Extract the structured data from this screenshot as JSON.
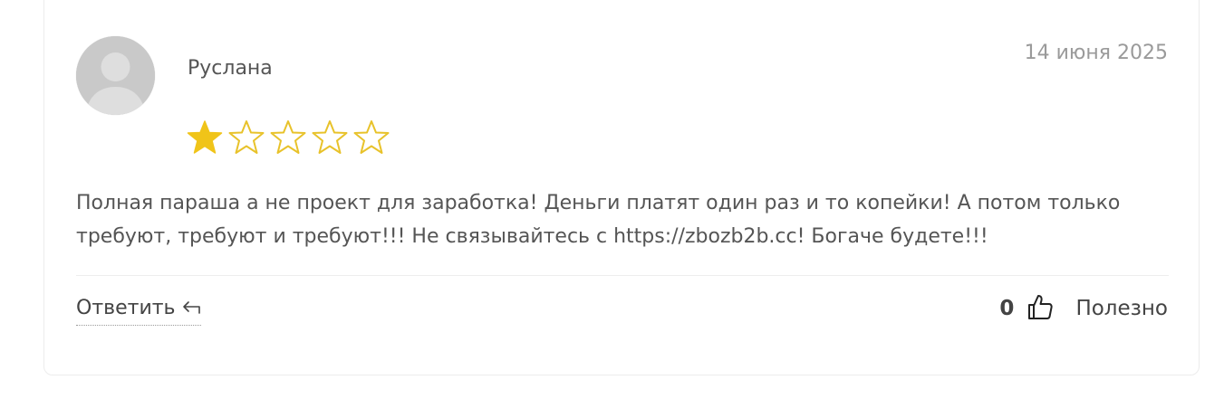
{
  "review": {
    "author": "Руслана",
    "date": "14 июня 2025",
    "rating": 1,
    "rating_max": 5,
    "text": "Полная параша а не проект для заработка! Деньги платят один раз и то копейки! А потом только требуют, требуют и требуют!!! Не связывайтесь с https://zbozb2b.cc! Богаче будете!!!"
  },
  "actions": {
    "reply_label": "Ответить",
    "reply_icon": "reply-arrow-icon",
    "likes_count": "0",
    "like_icon": "thumbs-up-icon",
    "useful_label": "Полезно"
  },
  "colors": {
    "star_filled": "#f0c419",
    "star_empty_outline": "#e8c22a",
    "text": "#555555",
    "date": "#9a9a9a"
  }
}
